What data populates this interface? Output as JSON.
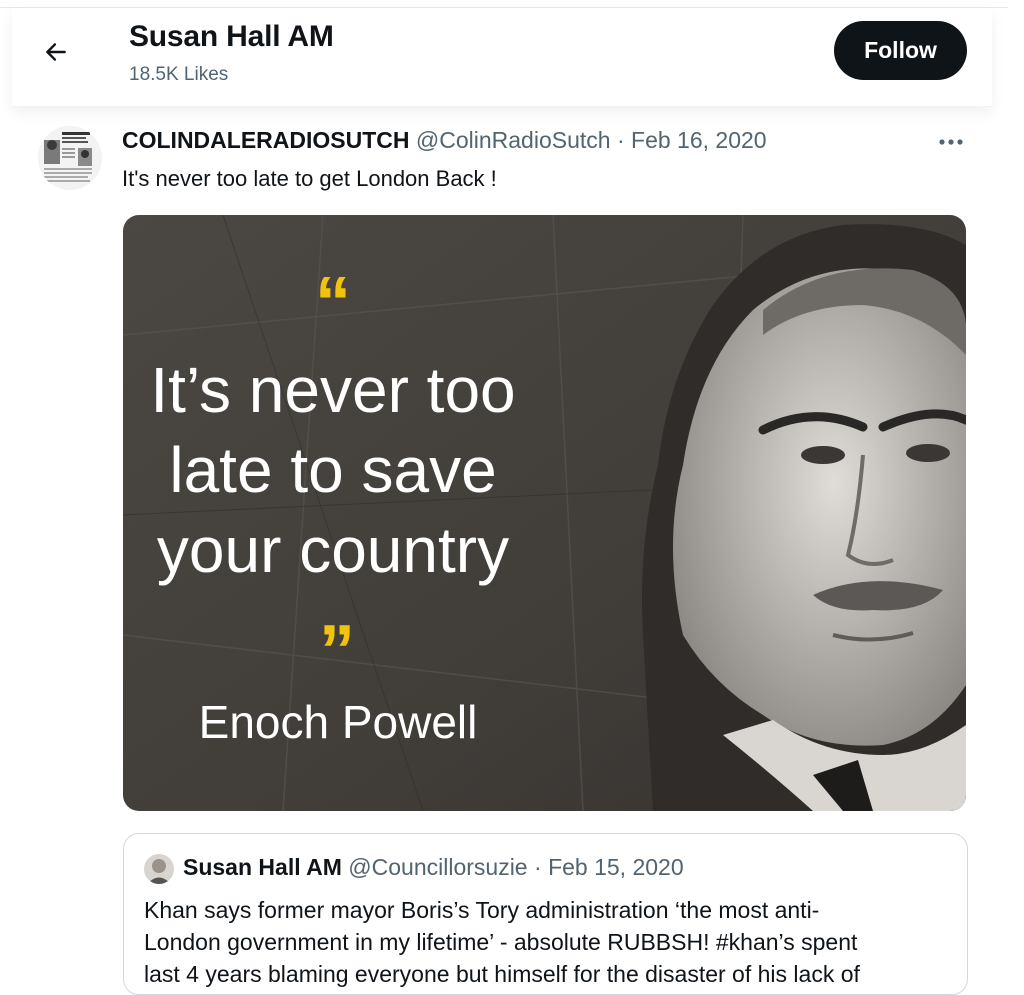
{
  "header": {
    "title": "Susan Hall AM",
    "likes": "18.5K Likes",
    "follow_label": "Follow",
    "back_icon": "arrow-left-icon"
  },
  "tweet": {
    "display_name": "COLINDALERADIOSUTCH",
    "handle": "@ColinRadioSutch",
    "separator": "·",
    "date": "Feb 16, 2020",
    "text": "It's never too late to get London Back !",
    "more_icon": "more-horizontal-icon",
    "image": {
      "quote_line_1": "It’s never too",
      "quote_line_2": "late to save",
      "quote_line_3": "your country",
      "attribution": "Enoch Powell",
      "open_quote": "“",
      "close_quote": "”",
      "accent_color": "#f2c30c"
    }
  },
  "quoted_tweet": {
    "display_name": "Susan Hall AM",
    "handle": "@Councillorsuzie",
    "separator": "·",
    "date": "Feb 15, 2020",
    "text_line_1": "Khan says former mayor Boris’s Tory administration ‘the most anti-",
    "text_line_2": "London government in my lifetime’ - absolute RUBBSH! #khan’s  spent",
    "text_line_3": "last 4 years blaming everyone but himself for the disaster of his lack of"
  }
}
